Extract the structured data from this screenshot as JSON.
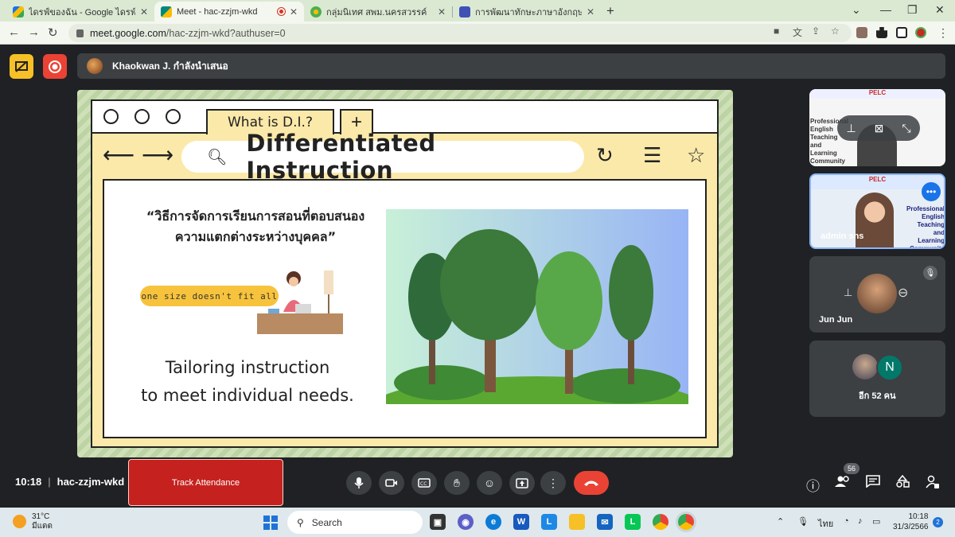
{
  "browser": {
    "tabs": [
      {
        "title": "ไดรฟ์ของฉัน - Google ไดรฟ์"
      },
      {
        "title": "Meet - hac-zzjm-wkd"
      },
      {
        "title": "กลุ่มนิเทศ สพม.นครสวรรค์"
      },
      {
        "title": "การพัฒนาทักษะภาษาอังกฤษ English"
      }
    ],
    "url_host": "meet.google.com",
    "url_path": "/hac-zzjm-wkd?authuser=0"
  },
  "meet": {
    "presenter_text": "Khaokwan J. กำลังนำเสนอ",
    "meeting_time": "10:18",
    "meeting_code": "hac-zzjm-wkd",
    "track_attendance_label": "Track Attendance",
    "participants_count": "56",
    "participants": [
      {
        "name": ""
      },
      {
        "name": "admin sns"
      },
      {
        "name": "Jun Jun"
      },
      {
        "name": "อีก 52 คน",
        "avatar_letter": "N"
      }
    ]
  },
  "slide": {
    "tab_label": "What is D.I.?",
    "title": "Differentiated Instruction",
    "quote_line1": "“วิธีการจัดการเรียนการสอนที่ตอบสนอง",
    "quote_line2": "ความแตกต่างระหว่างบุคคล”",
    "pill_text": "one size doesn't fit all",
    "tagline_line1": "Tailoring instruction",
    "tagline_line2": "to meet individual needs."
  },
  "thumb_text": {
    "pelc_banner": "PELC",
    "community_lines": [
      "Professional",
      "English",
      "Teaching",
      "and",
      "Learning",
      "Community"
    ]
  },
  "taskbar": {
    "temperature": "31°C",
    "weather_desc": "มีแดด",
    "search_label": "Search",
    "lang": "ไทย",
    "time": "10:18",
    "date": "31/3/2566",
    "notif_count": "2"
  },
  "colors": {
    "end_call": "#ea4335",
    "track_btn": "#c5221f",
    "slide_bg": "#fbe9a9",
    "pill": "#f7c33c"
  }
}
